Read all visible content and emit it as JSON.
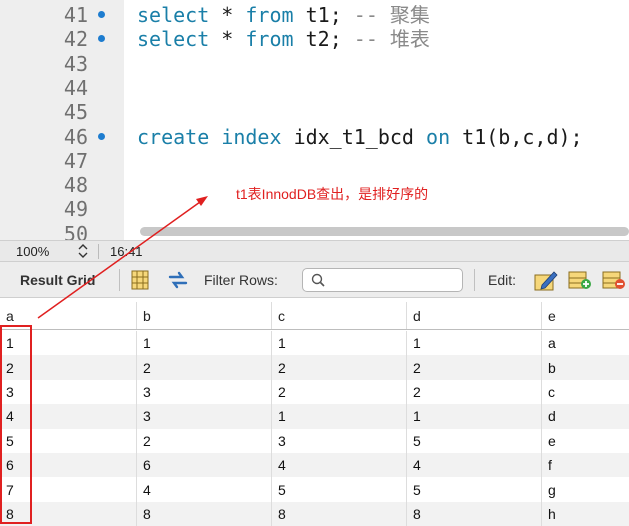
{
  "editor": {
    "lines": [
      {
        "num": "41",
        "dot": true,
        "code": [
          [
            "kw",
            "select"
          ],
          [
            "",
            "*"
          ],
          [
            "kw",
            "from"
          ],
          [
            "",
            "t1;"
          ],
          [
            "cm",
            "-- 聚集"
          ]
        ]
      },
      {
        "num": "42",
        "dot": true,
        "code": [
          [
            "kw",
            "select"
          ],
          [
            "",
            "*"
          ],
          [
            "kw",
            "from"
          ],
          [
            "",
            "t2;"
          ],
          [
            "cm",
            "-- 堆表"
          ]
        ]
      },
      {
        "num": "43",
        "dot": false,
        "code": []
      },
      {
        "num": "44",
        "dot": false,
        "code": []
      },
      {
        "num": "45",
        "dot": false,
        "code": []
      },
      {
        "num": "46",
        "dot": true,
        "code": [
          [
            "kw",
            "create"
          ],
          [
            "kw",
            "index"
          ],
          [
            "",
            "idx_t1_bcd"
          ],
          [
            "kw",
            "on"
          ],
          [
            "",
            "t1(b,c,d);"
          ]
        ]
      },
      {
        "num": "47",
        "dot": false,
        "code": []
      },
      {
        "num": "48",
        "dot": false,
        "code": []
      },
      {
        "num": "49",
        "dot": false,
        "code": []
      },
      {
        "num": "50",
        "dot": false,
        "code": []
      }
    ],
    "annotation": "t1表InnodDB查出，是排好序的"
  },
  "status": {
    "zoom": "100%",
    "cursor": "16:41"
  },
  "toolbar": {
    "result_grid": "Result Grid",
    "filter_label": "Filter Rows:",
    "filter_value": "",
    "edit_label": "Edit:"
  },
  "grid": {
    "columns": [
      "a",
      "b",
      "c",
      "d",
      "e"
    ],
    "rows": [
      [
        "1",
        "1",
        "1",
        "1",
        "a"
      ],
      [
        "2",
        "2",
        "2",
        "2",
        "b"
      ],
      [
        "3",
        "3",
        "2",
        "2",
        "c"
      ],
      [
        "4",
        "3",
        "1",
        "1",
        "d"
      ],
      [
        "5",
        "2",
        "3",
        "5",
        "e"
      ],
      [
        "6",
        "6",
        "4",
        "4",
        "f"
      ],
      [
        "7",
        "4",
        "5",
        "5",
        "g"
      ],
      [
        "8",
        "8",
        "8",
        "8",
        "h"
      ]
    ]
  },
  "colors": {
    "keyword": "#1a7fa8",
    "comment": "#8a8a8a",
    "annotation": "#e02020",
    "breakpoint_dot": "#1d7ccf"
  }
}
